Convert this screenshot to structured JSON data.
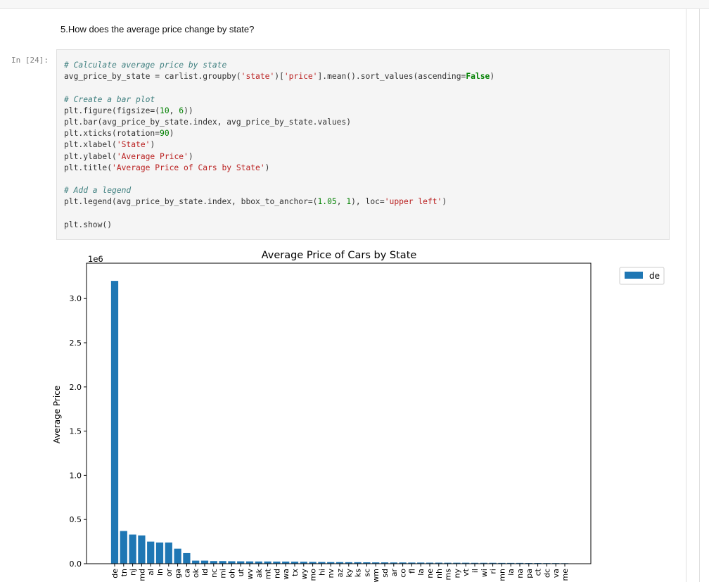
{
  "markdown": {
    "heading": "5.How does the average price change by state?"
  },
  "cell": {
    "prompt": "In [24]:",
    "code": {
      "c1": "# Calculate average price by state",
      "l2a": "avg_price_by_state = carlist.groupby(",
      "l2s1": "'state'",
      "l2b": ")[",
      "l2s2": "'price'",
      "l2c": "].mean().sort_values(ascending=",
      "l2k": "False",
      "l2d": ")",
      "c2": "# Create a bar plot",
      "l4a": "plt.figure(figsize=(",
      "l4n1": "10",
      "l4b": ", ",
      "l4n2": "6",
      "l4c": "))",
      "l5": "plt.bar(avg_price_by_state.index, avg_price_by_state.values)",
      "l6a": "plt.xticks(rotation=",
      "l6n": "90",
      "l6b": ")",
      "l7a": "plt.xlabel(",
      "l7s": "'State'",
      "l7b": ")",
      "l8a": "plt.ylabel(",
      "l8s": "'Average Price'",
      "l8b": ")",
      "l9a": "plt.title(",
      "l9s": "'Average Price of Cars by State'",
      "l9b": ")",
      "c3": "# Add a legend",
      "l11a": "plt.legend(avg_price_by_state.index, bbox_to_anchor=(",
      "l11n1": "1.05",
      "l11b": ", ",
      "l11n2": "1",
      "l11c": "), loc=",
      "l11s": "'upper left'",
      "l11d": ")",
      "l13": "plt.show()"
    }
  },
  "chart_data": {
    "type": "bar",
    "title": "Average Price of Cars by State",
    "ylabel": "Average Price",
    "xlabel": "",
    "offset_label": "1e6",
    "ylim": [
      0,
      3.4
    ],
    "yticks": [
      "0.0",
      "0.5",
      "1.0",
      "1.5",
      "2.0",
      "2.5",
      "3.0"
    ],
    "color": "#1f77b4",
    "legend": {
      "entries": [
        "de"
      ],
      "placement": "outside upper-right"
    },
    "categories": [
      "de",
      "tn",
      "nj",
      "md",
      "al",
      "in",
      "or",
      "ga",
      "ca",
      "ok",
      "id",
      "nc",
      "mi",
      "oh",
      "ut",
      "wv",
      "ak",
      "mt",
      "nd",
      "wa",
      "tx",
      "wy",
      "mo",
      "hi",
      "nv",
      "az",
      "ky",
      "ks",
      "sc",
      "wm",
      "sd",
      "ar",
      "co",
      "fl",
      "la",
      "ne",
      "nh",
      "ms",
      "ny",
      "vt",
      "il",
      "wi",
      "ri",
      "mn",
      "ia",
      "na",
      "pa",
      "ct",
      "dc",
      "va",
      "me"
    ],
    "values": [
      3.2,
      0.37,
      0.33,
      0.32,
      0.25,
      0.24,
      0.24,
      0.17,
      0.12,
      0.035,
      0.035,
      0.03,
      0.03,
      0.028,
      0.027,
      0.026,
      0.025,
      0.025,
      0.024,
      0.024,
      0.023,
      0.022,
      0.02,
      0.019,
      0.018,
      0.018,
      0.017,
      0.017,
      0.016,
      0.015,
      0.015,
      0.014,
      0.014,
      0.013,
      0.013,
      0.012,
      0.012,
      0.011,
      0.011,
      0.011,
      0.01,
      0.01,
      0.01,
      0.009,
      0.009,
      0.009,
      0.008,
      0.008,
      0.007,
      0.007,
      0.006
    ]
  }
}
